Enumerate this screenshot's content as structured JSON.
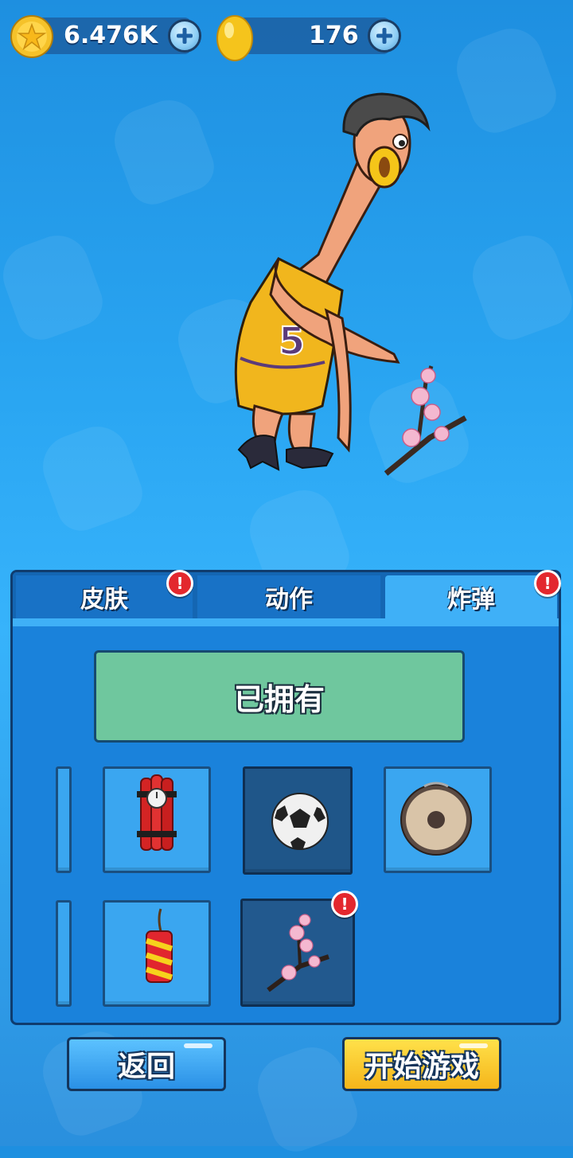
{
  "currency": {
    "coins": "6.476K",
    "gems": "176",
    "coin_icon": "star-coin-icon",
    "gem_icon": "gold-egg-icon"
  },
  "character": {
    "jersey_number": "5"
  },
  "tabs": [
    {
      "label": "皮肤",
      "active": false,
      "has_alert": true
    },
    {
      "label": "动作",
      "active": false,
      "has_alert": false
    },
    {
      "label": "炸弹",
      "active": true,
      "has_alert": true
    }
  ],
  "status_button": {
    "label": "已拥有"
  },
  "items": [
    {
      "name": "dynamite-bundle",
      "selected": false,
      "has_alert": false
    },
    {
      "name": "soccer-ball",
      "selected": true,
      "has_alert": false
    },
    {
      "name": "gong",
      "selected": false,
      "has_alert": false
    },
    {
      "name": "firecracker",
      "selected": false,
      "has_alert": false
    },
    {
      "name": "cherry-blossom-branch",
      "selected": false,
      "has_alert": true
    }
  ],
  "alert_symbol": "!",
  "buttons": {
    "back": "返回",
    "start": "开始游戏"
  },
  "colors": {
    "background": "#2aa6f2",
    "panel": "#1a82db",
    "active_tab": "#3fb0f7",
    "owned": "#6fc79e",
    "start": "#f5b51a",
    "alert": "#e3282e"
  }
}
